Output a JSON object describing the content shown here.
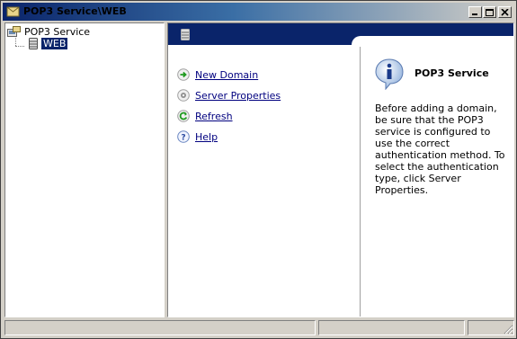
{
  "window": {
    "title": "POP3 Service\\WEB"
  },
  "tree": {
    "root_label": "POP3 Service",
    "child_label": "WEB"
  },
  "actions": [
    {
      "label": "New Domain",
      "icon": "green-arrow-icon"
    },
    {
      "label": "Server Properties",
      "icon": "properties-icon"
    },
    {
      "label": "Refresh",
      "icon": "refresh-icon"
    },
    {
      "label": "Help",
      "icon": "help-icon"
    }
  ],
  "info": {
    "title": "POP3 Service",
    "description": "Before adding a domain, be sure that the POP3 service is configured to use the correct authentication method. To select the authentication type, click Server Properties."
  },
  "colors": {
    "banner": "#0a246a",
    "link": "#00007f",
    "selection": "#0a246a"
  }
}
